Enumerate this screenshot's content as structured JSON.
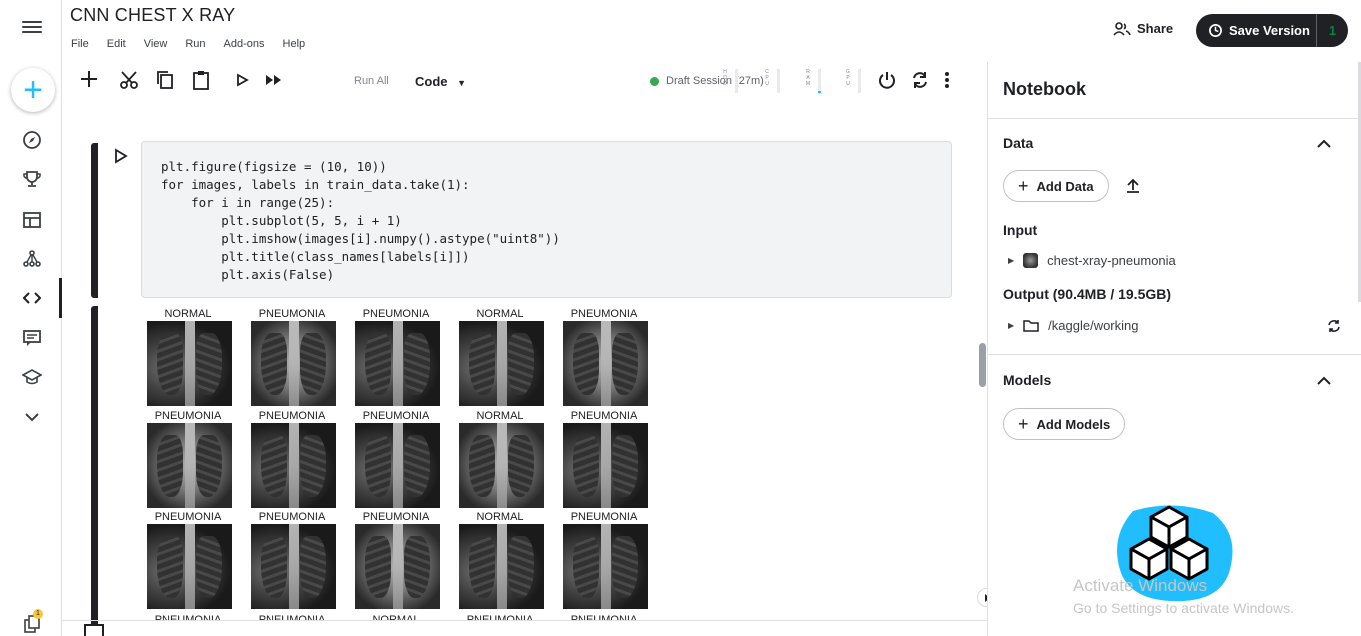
{
  "notebook": {
    "title": "CNN CHEST X RAY"
  },
  "menu": [
    "File",
    "Edit",
    "View",
    "Run",
    "Add-ons",
    "Help"
  ],
  "header": {
    "share_label": "Share",
    "save_label": "Save Version",
    "save_count": "1"
  },
  "toolbar": {
    "run_all_label": "Run All",
    "cell_type": "Code",
    "session_status": "Draft Session (27m)",
    "meters": [
      {
        "name": "HDD",
        "letters": "H D D",
        "level": 0.0
      },
      {
        "name": "CPU",
        "letters": "C P U",
        "level": 0.0
      },
      {
        "name": "RAM",
        "letters": "R A M",
        "level": 0.1
      },
      {
        "name": "GPU",
        "letters": "G P U",
        "level": 0.0
      }
    ],
    "status_color": "#34a853"
  },
  "code": {
    "lines": [
      "plt.figure(figsize = (10, 10))",
      "for images, labels in train_data.take(1):",
      "    for i in range(25):",
      "        plt.subplot(5, 5, i + 1)",
      "        plt.imshow(images[i].numpy().astype(\"uint8\"))",
      "        plt.title(class_names[labels[i]])",
      "        plt.axis(False)"
    ]
  },
  "output": {
    "rows": [
      [
        "NORMAL",
        "PNEUMONIA",
        "PNEUMONIA",
        "NORMAL",
        "PNEUMONIA"
      ],
      [
        "PNEUMONIA",
        "PNEUMONIA",
        "PNEUMONIA",
        "NORMAL",
        "PNEUMONIA"
      ],
      [
        "PNEUMONIA",
        "PNEUMONIA",
        "PNEUMONIA",
        "NORMAL",
        "PNEUMONIA"
      ]
    ],
    "partial_row": [
      "PNEUMONIA",
      "PNEUMONIA",
      "NORMAL",
      "PNEUMONIA",
      "PNEUMONIA"
    ]
  },
  "panel": {
    "title": "Notebook",
    "data_section": "Data",
    "add_data_label": "Add Data",
    "input_label": "Input",
    "input_item": "chest-xray-pneumonia",
    "output_label": "Output (90.4MB / 19.5GB)",
    "output_item": "/kaggle/working",
    "models_section": "Models",
    "add_models_label": "Add Models"
  },
  "watermark": {
    "line1": "Activate Windows",
    "line2": "Go to Settings to activate Windows."
  },
  "colors": {
    "accent": "#20beff",
    "dark": "#202124"
  }
}
